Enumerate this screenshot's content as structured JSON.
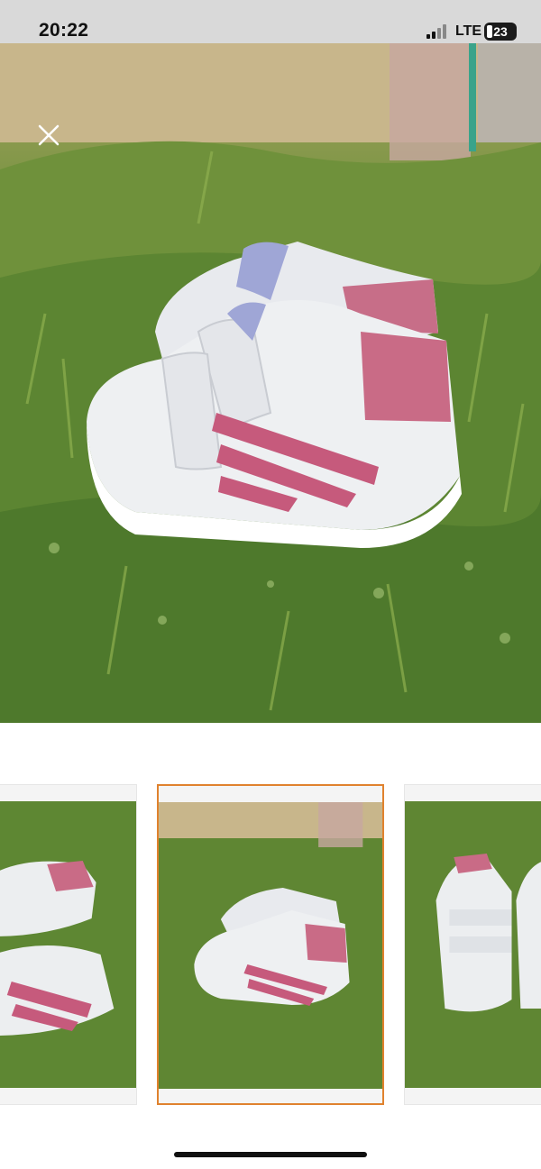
{
  "status_bar": {
    "time": "20:22",
    "network": "LTE",
    "battery": "23"
  },
  "viewer": {
    "close_icon": "close-icon",
    "main_image": "white-pink-baby-sneakers-on-grass",
    "thumbnails": [
      {
        "name": "thumbnail-1",
        "selected": false
      },
      {
        "name": "thumbnail-2",
        "selected": true
      },
      {
        "name": "thumbnail-3",
        "selected": false
      }
    ]
  },
  "colors": {
    "selected_border": "#e0822e",
    "grass": "#5f8633",
    "shoe_white": "#eef0f2",
    "shoe_pink": "#c96b86"
  }
}
